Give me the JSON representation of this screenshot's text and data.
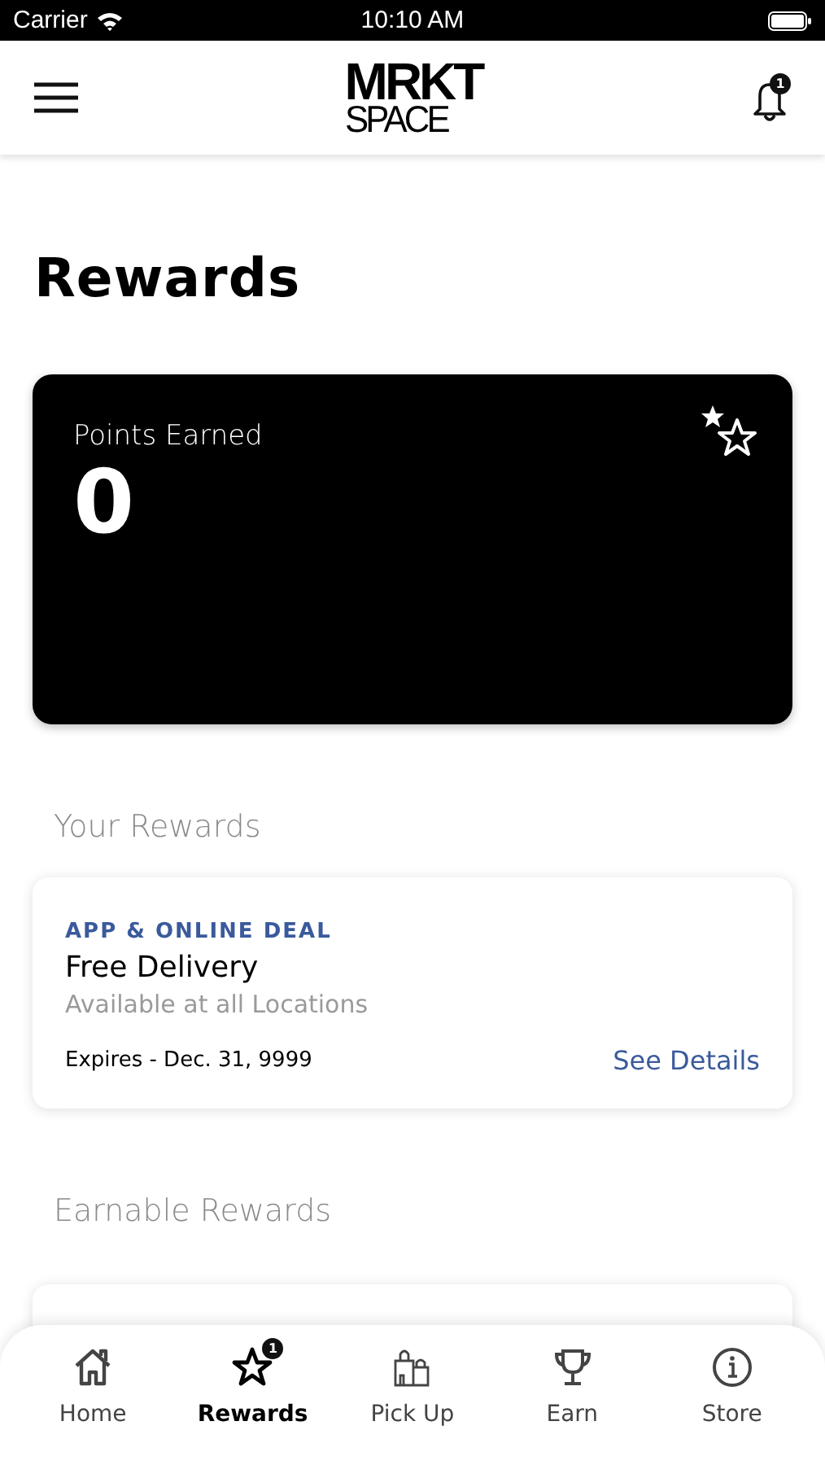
{
  "status_bar": {
    "carrier": "Carrier",
    "time": "10:10 AM"
  },
  "header": {
    "logo_top": "MRKT",
    "logo_bottom": "SPACE",
    "notification_count": "1"
  },
  "title": "Rewards",
  "points_card": {
    "label": "Points Earned",
    "value": "0"
  },
  "your_rewards": {
    "heading": "Your Rewards",
    "items": [
      {
        "category": "APP & ONLINE DEAL",
        "name": "Free Delivery",
        "availability": "Available at all Locations",
        "expires": "Expires - Dec. 31, 9999",
        "link": "See Details"
      }
    ]
  },
  "earnable_rewards": {
    "heading": "Earnable Rewards"
  },
  "tabs": [
    {
      "kind": "home",
      "label": "Home",
      "selected": false
    },
    {
      "kind": "rewards",
      "label": "Rewards",
      "selected": true,
      "badge": "1"
    },
    {
      "kind": "pickup",
      "label": "Pick Up",
      "selected": false
    },
    {
      "kind": "earn",
      "label": "Earn",
      "selected": false
    },
    {
      "kind": "store",
      "label": "Store",
      "selected": false
    }
  ]
}
